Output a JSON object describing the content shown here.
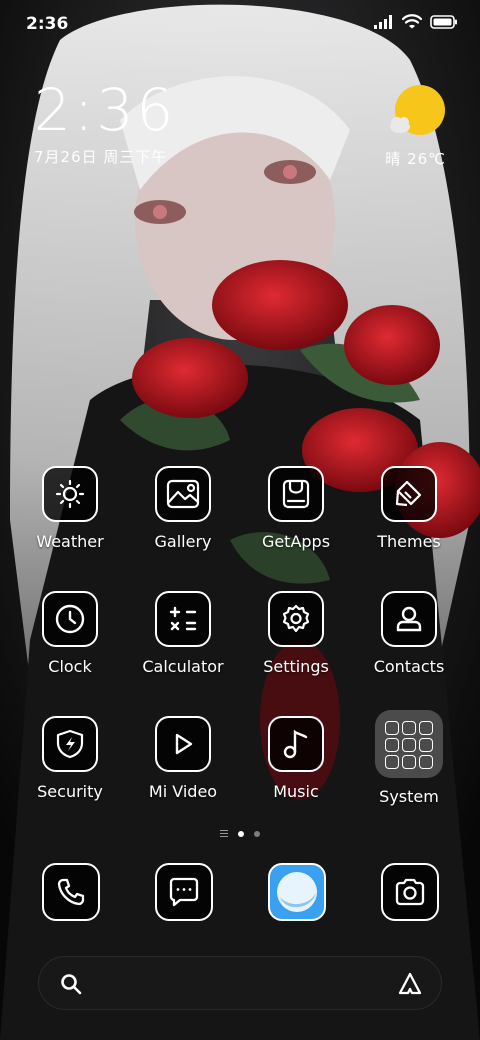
{
  "status_bar": {
    "time": "2:36",
    "icons": [
      "signal-icon",
      "wifi-icon",
      "battery-icon"
    ]
  },
  "clock_widget": {
    "time": "2:36",
    "date": "7月26日 周三下午"
  },
  "weather_widget": {
    "condition_icon": "sun-cloud-icon",
    "text": "晴 26℃",
    "sun_color": "#f7c61a"
  },
  "apps": [
    {
      "label": "Weather",
      "icon": "weather-icon"
    },
    {
      "label": "Gallery",
      "icon": "gallery-icon"
    },
    {
      "label": "GetApps",
      "icon": "getapps-icon"
    },
    {
      "label": "Themes",
      "icon": "themes-icon"
    },
    {
      "label": "Clock",
      "icon": "clock-icon"
    },
    {
      "label": "Calculator",
      "icon": "calculator-icon"
    },
    {
      "label": "Settings",
      "icon": "settings-icon"
    },
    {
      "label": "Contacts",
      "icon": "contacts-icon"
    },
    {
      "label": "Security",
      "icon": "security-icon"
    },
    {
      "label": "Mi Video",
      "icon": "mi-video-icon"
    },
    {
      "label": "Music",
      "icon": "music-icon"
    },
    {
      "label": "System",
      "icon": "folder-icon"
    }
  ],
  "page_indicator": {
    "pages": 2,
    "active_page": 1
  },
  "dock": [
    {
      "icon": "phone-icon"
    },
    {
      "icon": "messages-icon"
    },
    {
      "icon": "browser-icon",
      "accent": "#3aa0f0"
    },
    {
      "icon": "camera-icon"
    }
  ],
  "search_bar": {
    "left_icon": "search-icon",
    "right_icon": "assistant-icon"
  }
}
